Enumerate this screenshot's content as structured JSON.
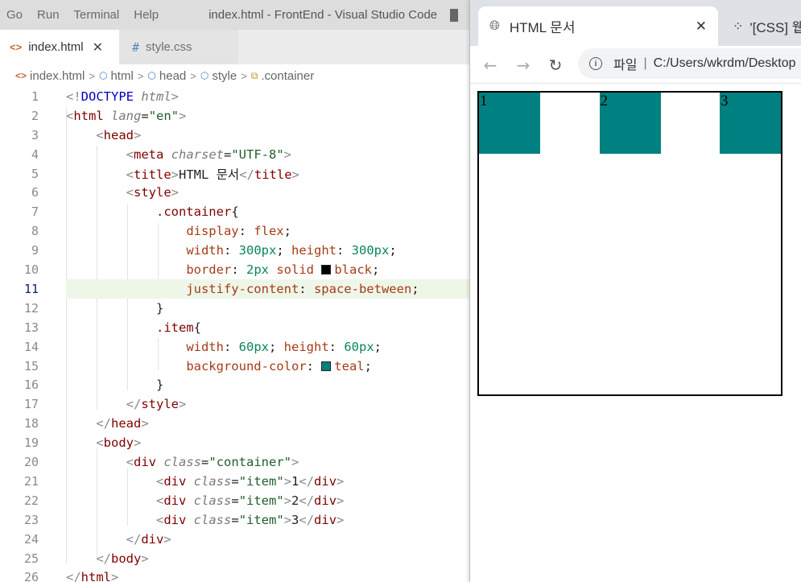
{
  "vscode": {
    "menu": [
      "Go",
      "Run",
      "Terminal",
      "Help"
    ],
    "window_title": "index.html - FrontEnd - Visual Studio Code",
    "tabs": [
      {
        "icon": "<>",
        "label": "index.html",
        "close": "✕"
      },
      {
        "icon": "#",
        "label": "style.css"
      }
    ],
    "breadcrumb": [
      "index.html",
      "html",
      "head",
      "style",
      ".container"
    ],
    "current_line": "11",
    "colors": {
      "accent_swatch_black": "#000000",
      "accent_swatch_teal": "#008080"
    }
  },
  "browser": {
    "tabs": [
      {
        "title": "HTML 문서",
        "close": "✕"
      },
      {
        "title": "'[CSS] 웹"
      }
    ],
    "address": {
      "scheme_label": "파일",
      "separator": "|",
      "url": "C:/Users/wkrdm/Desktop"
    },
    "items": [
      "1",
      "2",
      "3"
    ]
  }
}
